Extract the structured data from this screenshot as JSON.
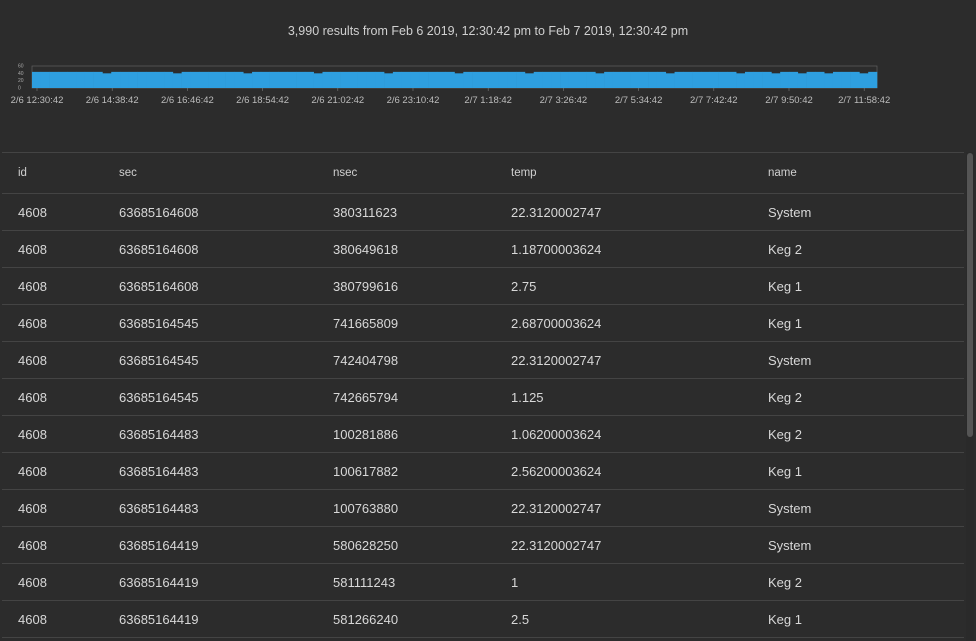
{
  "summary": "3,990 results from Feb 6 2019, 12:30:42 pm to Feb 7 2019, 12:30:42 pm",
  "chart_data": {
    "type": "bar",
    "title": "",
    "xlabel": "",
    "ylabel": "",
    "ylim": [
      0,
      60
    ],
    "y_ticks": [
      "60",
      "40",
      "20",
      "0"
    ],
    "tick_labels": [
      "2/6 12:30:42",
      "2/6 14:38:42",
      "2/6 16:46:42",
      "2/6 18:54:42",
      "2/6 21:02:42",
      "2/6 23:10:42",
      "2/7 1:18:42",
      "2/7 3:26:42",
      "2/7 5:34:42",
      "2/7 7:42:42",
      "2/7 9:50:42",
      "2/7 11:58:42"
    ],
    "bins": 96,
    "values": [
      44,
      44,
      44,
      44,
      44,
      44,
      44,
      44,
      40,
      44,
      44,
      44,
      44,
      44,
      44,
      44,
      40,
      44,
      44,
      44,
      44,
      44,
      44,
      44,
      40,
      44,
      44,
      44,
      44,
      44,
      44,
      44,
      40,
      44,
      44,
      44,
      44,
      44,
      44,
      44,
      40,
      44,
      44,
      44,
      44,
      44,
      44,
      44,
      40,
      44,
      44,
      44,
      44,
      44,
      44,
      44,
      40,
      44,
      44,
      44,
      44,
      44,
      44,
      44,
      40,
      44,
      44,
      44,
      44,
      44,
      44,
      44,
      40,
      44,
      44,
      44,
      44,
      44,
      44,
      44,
      40,
      44,
      44,
      44,
      40,
      44,
      44,
      40,
      44,
      44,
      40,
      44,
      44,
      44,
      40,
      44
    ],
    "color": "#2e9fe0",
    "grid": false
  },
  "table": {
    "columns": [
      "id",
      "sec",
      "nsec",
      "temp",
      "name"
    ],
    "rows": [
      [
        "4608",
        "63685164608",
        "380311623",
        "22.3120002747",
        "System"
      ],
      [
        "4608",
        "63685164608",
        "380649618",
        "1.18700003624",
        "Keg 2"
      ],
      [
        "4608",
        "63685164608",
        "380799616",
        "2.75",
        "Keg 1"
      ],
      [
        "4608",
        "63685164545",
        "741665809",
        "2.68700003624",
        "Keg 1"
      ],
      [
        "4608",
        "63685164545",
        "742404798",
        "22.3120002747",
        "System"
      ],
      [
        "4608",
        "63685164545",
        "742665794",
        "1.125",
        "Keg 2"
      ],
      [
        "4608",
        "63685164483",
        "100281886",
        "1.06200003624",
        "Keg 2"
      ],
      [
        "4608",
        "63685164483",
        "100617882",
        "2.56200003624",
        "Keg 1"
      ],
      [
        "4608",
        "63685164483",
        "100763880",
        "22.3120002747",
        "System"
      ],
      [
        "4608",
        "63685164419",
        "580628250",
        "22.3120002747",
        "System"
      ],
      [
        "4608",
        "63685164419",
        "581111243",
        "1",
        "Keg 2"
      ],
      [
        "4608",
        "63685164419",
        "581266240",
        "2.5",
        "Keg 1"
      ]
    ]
  }
}
